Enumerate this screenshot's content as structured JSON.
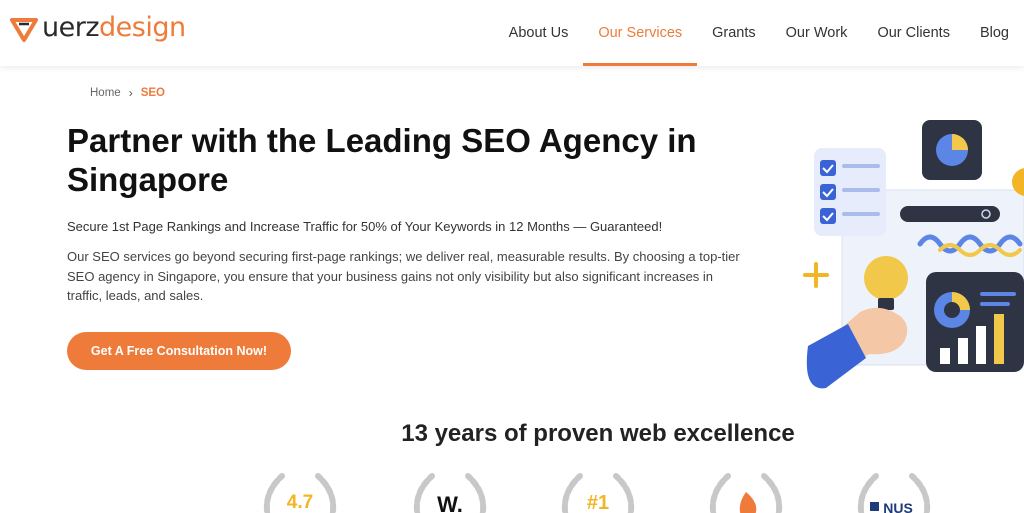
{
  "brand": {
    "name_part1": "uerz",
    "name_part2": "design",
    "accent": "#ee7b3a"
  },
  "nav": {
    "items": [
      {
        "label": "About Us",
        "active": false
      },
      {
        "label": "Our Services",
        "active": true
      },
      {
        "label": "Grants",
        "active": false
      },
      {
        "label": "Our Work",
        "active": false
      },
      {
        "label": "Our Clients",
        "active": false
      },
      {
        "label": "Blog",
        "active": false
      }
    ]
  },
  "breadcrumb": {
    "home": "Home",
    "current": "SEO"
  },
  "hero": {
    "title": "Partner with the Leading SEO Agency in Singapore",
    "subtitle": "Secure 1st Page Rankings and Increase Traffic for 50% of Your Keywords in 12 Months — Guaranteed!",
    "description": "Our SEO services go beyond securing first-page rankings; we deliver real, measurable results. By choosing a top-tier SEO agency in Singapore, you ensure that your business gains not only visibility but also significant increases in traffic, leads, and sales.",
    "cta_label": "Get A Free Consultation Now!"
  },
  "excellence": {
    "heading": "13 years of proven web excellence"
  },
  "awards": [
    {
      "label": "4.7",
      "color": "#f2b526"
    },
    {
      "label": "W.",
      "color": "#111111"
    },
    {
      "label": "#1",
      "color": "#f2b526"
    },
    {
      "label": "",
      "color": "#ee7b3a"
    },
    {
      "label": "NUS",
      "color": "#1e3a7a"
    }
  ]
}
